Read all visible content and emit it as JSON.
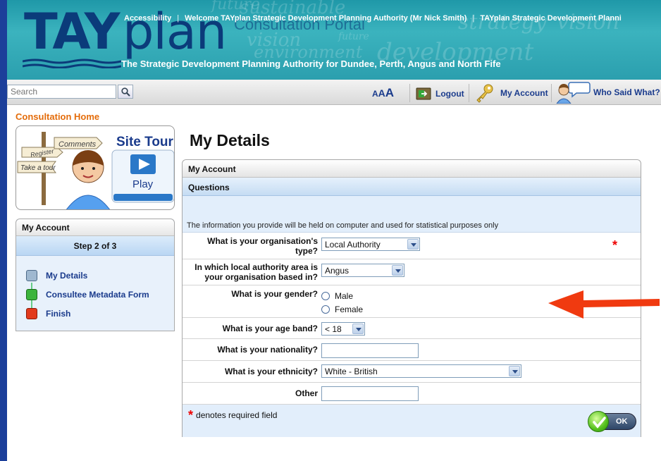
{
  "banner": {
    "logo_tay": "TAY",
    "logo_plan": "plan",
    "portal_title": "Consultation Portal",
    "topnav": [
      "Accessibility",
      "Welcome TAYplan Strategic Development Planning Authority (Mr Nick Smith)",
      "TAYplan Strategic Development Planni"
    ],
    "tagline": "The Strategic Development Planning Authority for Dundee, Perth, Angus and North Fife",
    "ghost_words": [
      "future",
      "sustainable",
      "strategy",
      "vision",
      "environment",
      "development",
      "future",
      "vision"
    ]
  },
  "toolbar": {
    "search_placeholder": "Search",
    "font_size_labels": [
      "A",
      "A",
      "A"
    ],
    "logout_label": "Logout",
    "my_account_label": "My Account",
    "who_said_label": "Who Said What?"
  },
  "breadcrumb": "Consultation Home",
  "site_tour": {
    "title": "Site Tour",
    "play_label": "Play",
    "sign_words": [
      "Register",
      "Comments",
      "Take a tour"
    ]
  },
  "sidebar": {
    "header": "My Account",
    "step": "Step 2 of 3",
    "items": [
      {
        "label": "My Details",
        "color": "#9fb8d0"
      },
      {
        "label": "Consultee Metadata Form",
        "color": "#3cb43c"
      },
      {
        "label": "Finish",
        "color": "#e23a1c"
      }
    ]
  },
  "main": {
    "title": "My Details",
    "panel_header": "My Account",
    "questions_header": "Questions",
    "info_text": "The information you provide will be held on computer and used for statistical purposes only",
    "questions": [
      {
        "label": "What is your organisation's type?",
        "type": "select",
        "value": "Local Authority"
      },
      {
        "label": "In which local authority area is your organisation based in?",
        "type": "select",
        "value": "Angus"
      },
      {
        "label": "What is your gender?",
        "type": "radio",
        "options": [
          "Male",
          "Female"
        ]
      },
      {
        "label": "What is your age band?",
        "type": "select",
        "value": "< 18"
      },
      {
        "label": "What is your nationality?",
        "type": "text",
        "value": ""
      },
      {
        "label": "What is your ethnicity?",
        "type": "select",
        "value": "White - British"
      },
      {
        "label": "Other",
        "type": "text",
        "value": ""
      }
    ],
    "required_star": "*",
    "required_note": "denotes required field",
    "ok_label": "OK"
  },
  "colors": {
    "accent_orange": "#e46c0a",
    "link_blue": "#1a3b8c",
    "required_red": "#ee0000",
    "annotation_arrow": "#f03a10"
  }
}
